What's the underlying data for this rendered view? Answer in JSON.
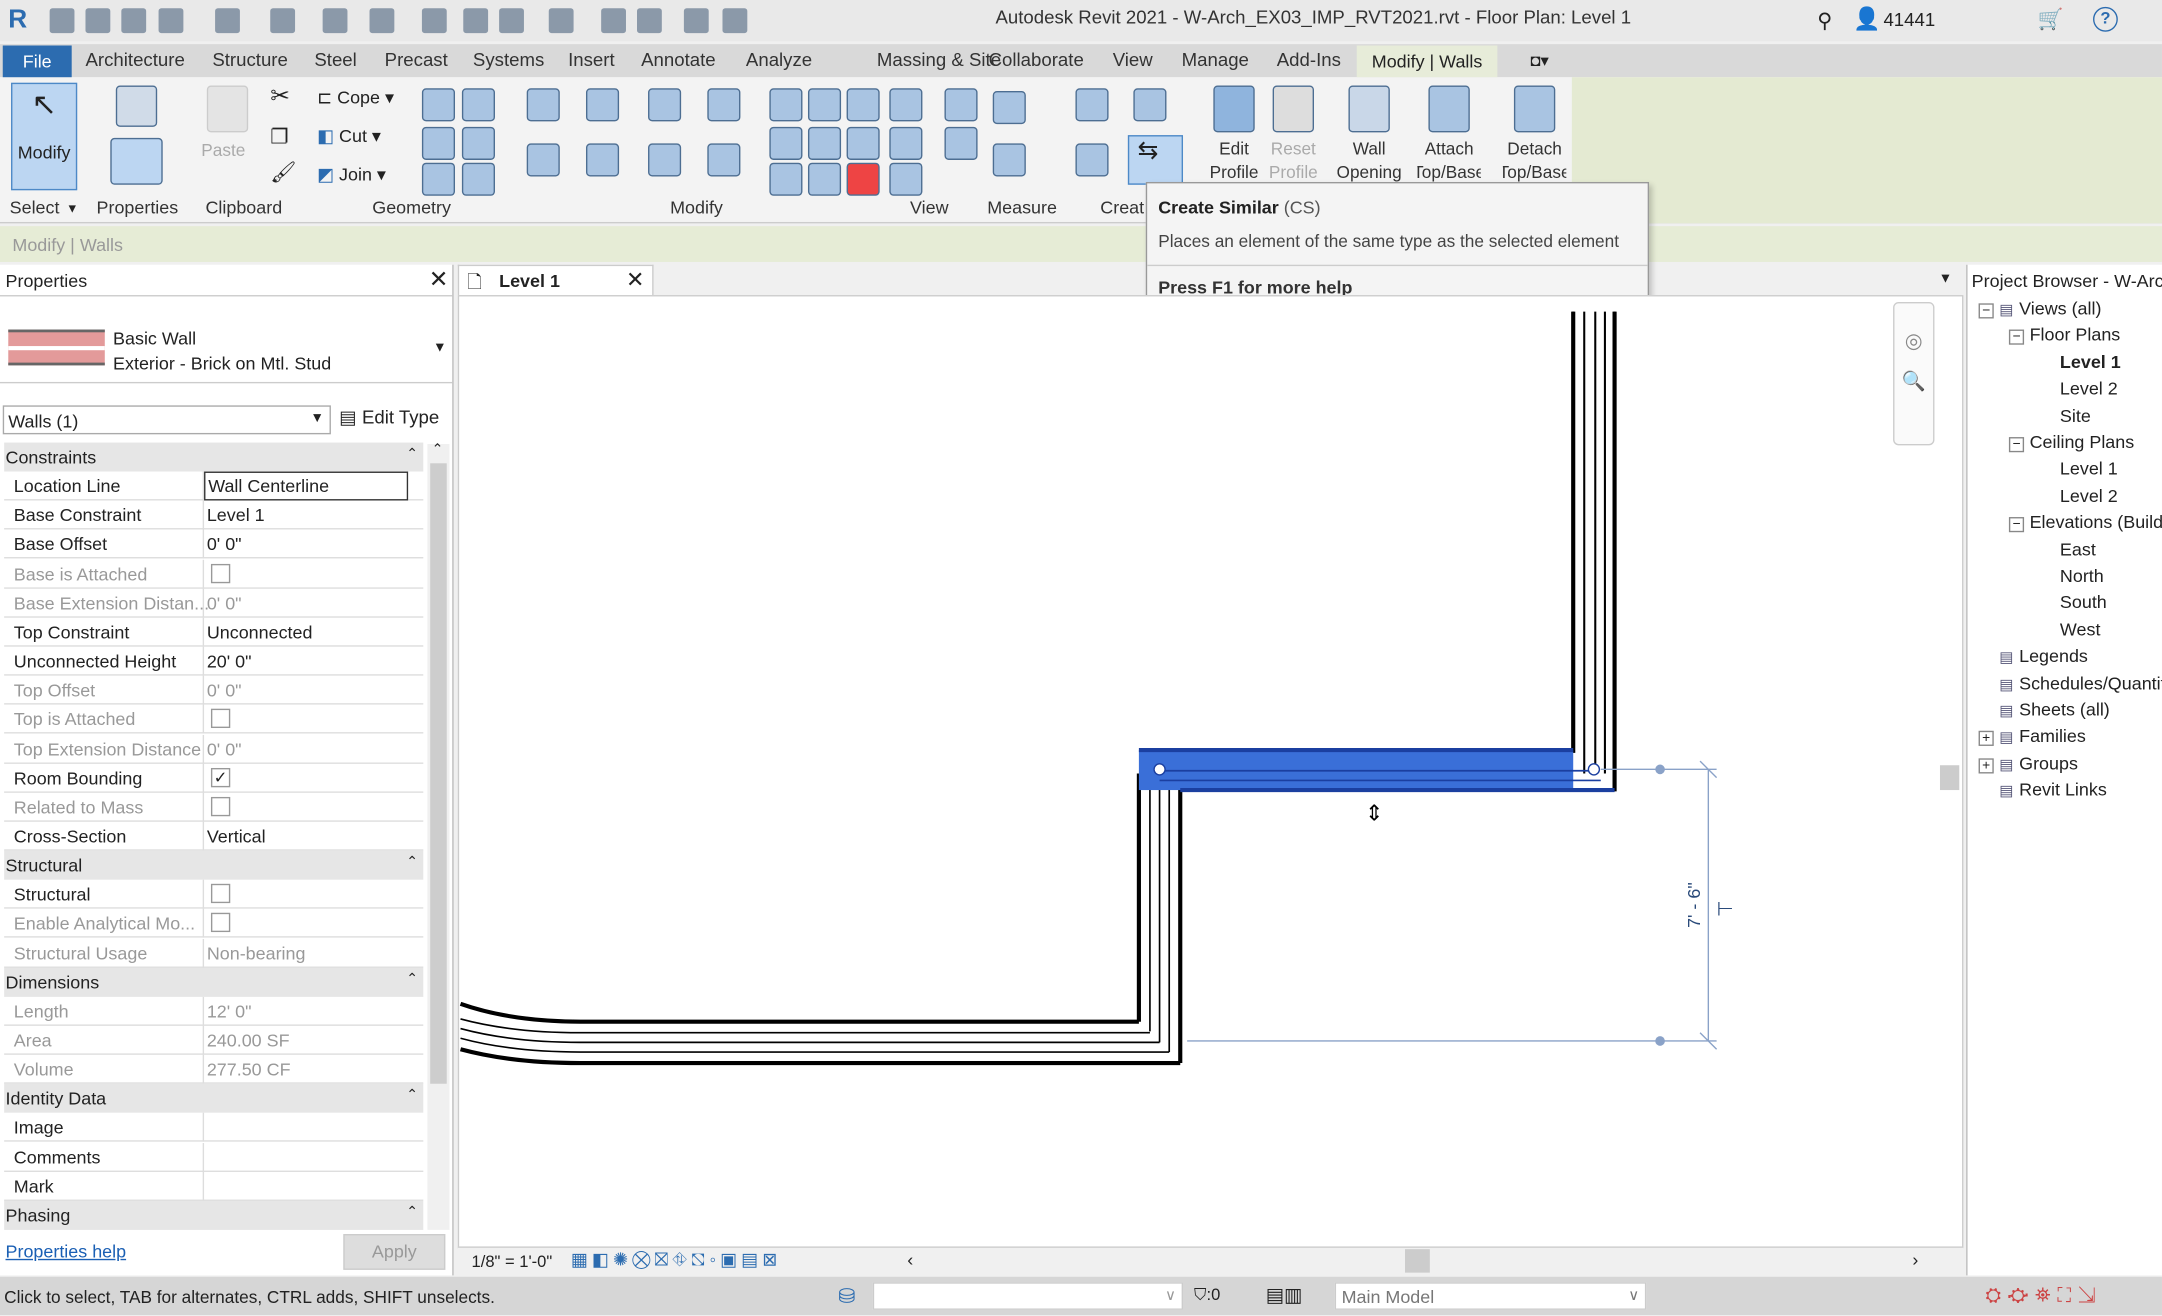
{
  "title": "Autodesk Revit 2021 - W-Arch_EX03_IMP_RVT2021.rvt - Floor Plan: Level 1",
  "user": "41441",
  "tabs": [
    "File",
    "Architecture",
    "Structure",
    "Steel",
    "Precast",
    "Systems",
    "Insert",
    "Annotate",
    "Analyze",
    "Massing & Site",
    "Collaborate",
    "View",
    "Manage",
    "Add-Ins",
    "Modify | Walls"
  ],
  "ribbon": {
    "panels": [
      "Select",
      "Properties",
      "Clipboard",
      "Geometry",
      "Modify",
      "View",
      "Measure",
      "Creat"
    ],
    "modify": "Modify",
    "paste": "Paste",
    "cope": "Cope",
    "cut": "Cut",
    "join": "Join",
    "edit_profile": [
      "Edit",
      "Profile"
    ],
    "reset_profile": [
      "Reset",
      "Profile"
    ],
    "wall_opening": [
      "Wall",
      "Opening"
    ],
    "attach": [
      "Attach",
      "Top/Base"
    ],
    "detach": [
      "Detach",
      "Top/Base"
    ]
  },
  "context_bar": "Modify | Walls",
  "tooltip": {
    "title": "Create Similar",
    "shortcut": "(CS)",
    "desc": "Places an element of the same type as the selected element",
    "help": "Press F1 for more help"
  },
  "properties": {
    "header": "Properties",
    "family": "Basic Wall",
    "type": "Exterior - Brick on Mtl. Stud",
    "filter": "Walls (1)",
    "edit_type": "Edit Type",
    "items": [
      {
        "g": "Constraints"
      },
      {
        "k": "Location Line",
        "v": "Wall Centerline",
        "edit": true
      },
      {
        "k": "Base Constraint",
        "v": "Level 1"
      },
      {
        "k": "Base Offset",
        "v": "0' 0\""
      },
      {
        "k": "Base is Attached",
        "cb": false,
        "dis": true
      },
      {
        "k": "Base Extension Distan...",
        "v": "0' 0\"",
        "dis": true
      },
      {
        "k": "Top Constraint",
        "v": "Unconnected"
      },
      {
        "k": "Unconnected Height",
        "v": "20' 0\""
      },
      {
        "k": "Top Offset",
        "v": "0' 0\"",
        "dis": true
      },
      {
        "k": "Top is Attached",
        "cb": false,
        "dis": true
      },
      {
        "k": "Top Extension Distance",
        "v": "0' 0\"",
        "dis": true
      },
      {
        "k": "Room Bounding",
        "cb": true
      },
      {
        "k": "Related to Mass",
        "cb": false,
        "dis": true
      },
      {
        "k": "Cross-Section",
        "v": "Vertical"
      },
      {
        "g": "Structural"
      },
      {
        "k": "Structural",
        "cb": false
      },
      {
        "k": "Enable Analytical Mo...",
        "cb": false,
        "dis": true
      },
      {
        "k": "Structural Usage",
        "v": "Non-bearing",
        "dis": true
      },
      {
        "g": "Dimensions"
      },
      {
        "k": "Length",
        "v": "12' 0\"",
        "dis": true
      },
      {
        "k": "Area",
        "v": "240.00 SF",
        "dis": true
      },
      {
        "k": "Volume",
        "v": "277.50 CF",
        "dis": true
      },
      {
        "g": "Identity Data"
      },
      {
        "k": "Image",
        "v": ""
      },
      {
        "k": "Comments",
        "v": ""
      },
      {
        "k": "Mark",
        "v": ""
      },
      {
        "g": "Phasing"
      }
    ],
    "help_link": "Properties help",
    "apply": "Apply"
  },
  "view": {
    "tab": "Level 1",
    "dimension": "7' - 6\"",
    "scale": "1/8\" = 1'-0\""
  },
  "project_browser": {
    "title": "Project Browser - W-Arch",
    "nodes": [
      {
        "t": "Views (all)",
        "d": 0,
        "exp": "-"
      },
      {
        "t": "Floor Plans",
        "d": 1,
        "exp": "-"
      },
      {
        "t": "Level 1",
        "d": 2,
        "bold": true
      },
      {
        "t": "Level 2",
        "d": 2
      },
      {
        "t": "Site",
        "d": 2
      },
      {
        "t": "Ceiling Plans",
        "d": 1,
        "exp": "-"
      },
      {
        "t": "Level 1",
        "d": 2
      },
      {
        "t": "Level 2",
        "d": 2
      },
      {
        "t": "Elevations (Building Elevation)",
        "d": 1,
        "exp": "-"
      },
      {
        "t": "East",
        "d": 2
      },
      {
        "t": "North",
        "d": 2
      },
      {
        "t": "South",
        "d": 2
      },
      {
        "t": "West",
        "d": 2
      },
      {
        "t": "Legends",
        "d": 0
      },
      {
        "t": "Schedules/Quantities (all)",
        "d": 0
      },
      {
        "t": "Sheets (all)",
        "d": 0
      },
      {
        "t": "Families",
        "d": 0,
        "exp": "+"
      },
      {
        "t": "Groups",
        "d": 0,
        "exp": "+"
      },
      {
        "t": "Revit Links",
        "d": 0
      }
    ]
  },
  "status": {
    "hint": "Click to select, TAB for alternates, CTRL adds, SHIFT unselects.",
    "filter_count": ":0",
    "model": "Main Model"
  },
  "colors": {
    "file_tab": "#2c6cb0",
    "selected_wall": "#3a6fd8",
    "context_tab": "#e7ecd9"
  }
}
